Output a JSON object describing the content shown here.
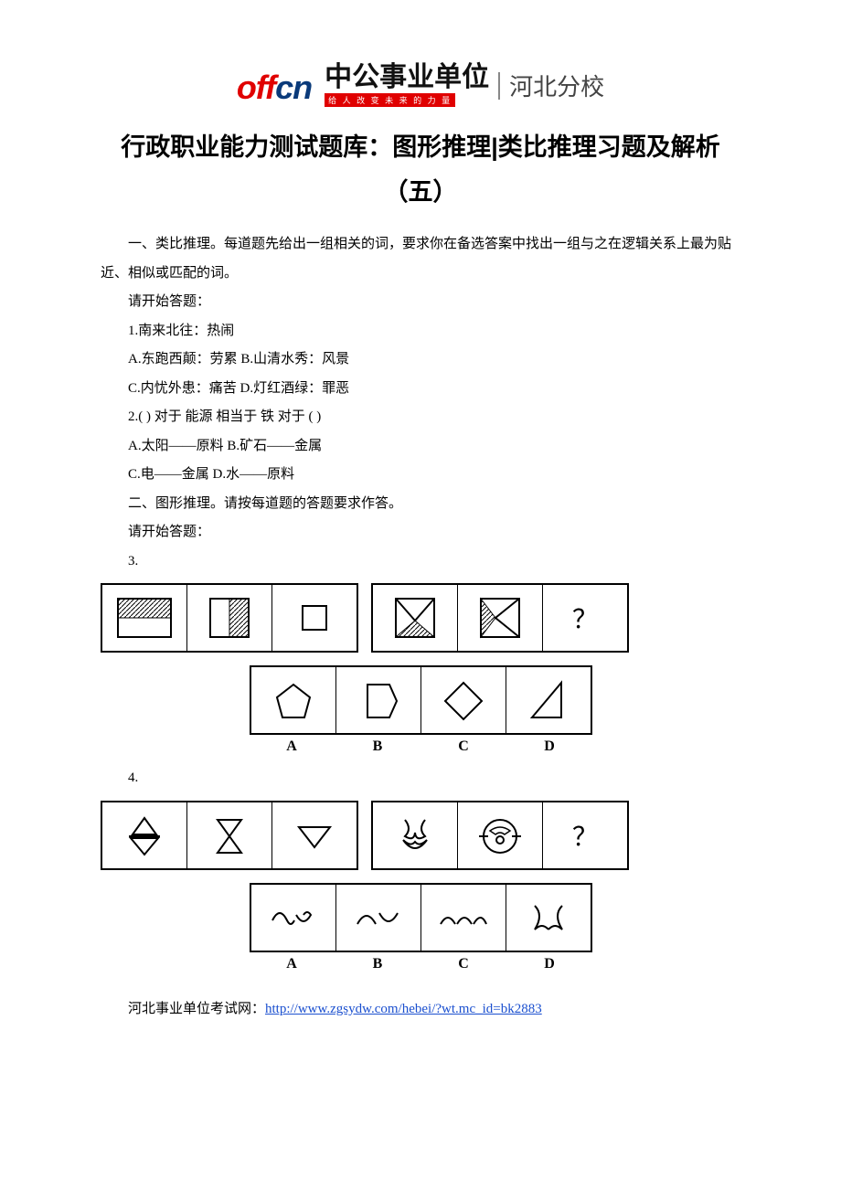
{
  "logo": {
    "brand_en": "offcn",
    "brand_zh": "中公事业单位",
    "slogan": "给 人 改 变 未 来 的 力 量",
    "branch": "河北分校"
  },
  "title": "行政职业能力测试题库：图形推理|类比推理习题及解析（五）",
  "section1_intro": "一、类比推理。每道题先给出一组相关的词，要求你在备选答案中找出一组与之在逻辑关系上最为贴近、相似或匹配的词。",
  "begin": "请开始答题：",
  "q1": {
    "num": "1.南来北往：热闹",
    "a": "A.东跑西颠：劳累  B.山清水秀：风景",
    "c": "C.内忧外患：痛苦  D.灯红酒绿：罪恶"
  },
  "q2": {
    "num": "2.(  ) 对于 能源 相当于 铁 对于 (  )",
    "a": "A.太阳——原料  B.矿石——金属",
    "c": "C.电——金属  D.水——原料"
  },
  "section2_intro": "二、图形推理。请按每道题的答题要求作答。",
  "q3": {
    "num": "3."
  },
  "q4": {
    "num": "4."
  },
  "choice_labels": [
    "A",
    "B",
    "C",
    "D"
  ],
  "qmark": "？",
  "footer": {
    "label": "河北事业单位考试网：",
    "url_text": "http://www.zgsydw.com/hebei/?wt.mc_id=bk2883"
  }
}
